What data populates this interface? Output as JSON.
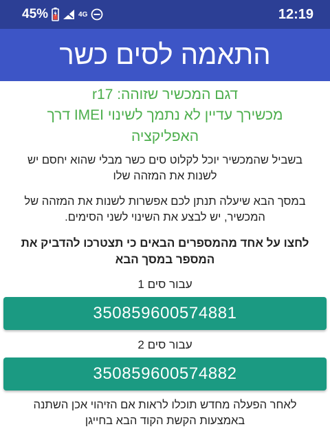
{
  "status_bar": {
    "battery_percent": "45%",
    "network_label": "4G",
    "time": "12:19",
    "icons": [
      "battery-icon",
      "signal-icon",
      "do-not-disturb-icon"
    ]
  },
  "app_bar": {
    "title": "התאמה לסים כשר"
  },
  "content": {
    "model_line": "דגם המכשיר שזוהה: r17",
    "imei_warning": "מכשירך עדיין לא נתמך לשינוי IMEI דרך האפליקציה",
    "paragraph1": "בשביל שהמכשיר יוכל לקלוט סים כשר מבלי שהוא יחסם יש לשנות את המזהה שלו",
    "paragraph2": "במסך הבא שיעלה תנתן לכם אפשרות לשנות את המזהה של המכשיר, יש לבצע את השינוי לשני הסימים.",
    "instruction": "לחצו על אחד מהמספרים הבאים כי תצטרכו להדביק את המספר במסך הבא",
    "sim1_label": "עבור סים 1",
    "sim1_imei": "350859600574881",
    "sim2_label": "עבור סים 2",
    "sim2_imei": "350859600574882",
    "after_note": "לאחר הפעלה מחדש תוכלו לראות אם הזיהוי אכן השתנה באמצעות הקשת הקוד הבא בחייגן"
  },
  "colors": {
    "status_bar": "#2c3f95",
    "app_bar": "#3d55c6",
    "accent_green": "#4cae4c",
    "button_teal": "#1b9a82"
  }
}
